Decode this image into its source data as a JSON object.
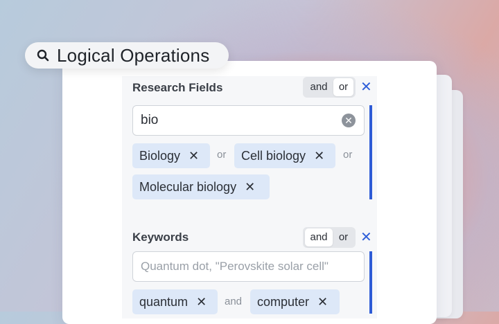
{
  "search": {
    "title": "Logical Operations",
    "icon": "search-icon"
  },
  "sections": [
    {
      "title": "Research Fields",
      "toggle": {
        "and": "and",
        "or": "or",
        "selected": "or"
      },
      "close": "✕",
      "input": {
        "value": "bio",
        "placeholder": ""
      },
      "chips": [
        "Biology",
        "Cell biology",
        "Molecular biology"
      ],
      "connector": "or"
    },
    {
      "title": "Keywords",
      "toggle": {
        "and": "and",
        "or": "or",
        "selected": "and"
      },
      "close": "✕",
      "input": {
        "value": "",
        "placeholder": "Quantum dot, \"Perovskite solar cell\""
      },
      "chips": [
        "quantum",
        "computer"
      ],
      "connector": "and"
    }
  ],
  "chip_remove": "✕",
  "colors": {
    "accent": "#2e5bd6",
    "chip_bg": "#dde8f8"
  }
}
